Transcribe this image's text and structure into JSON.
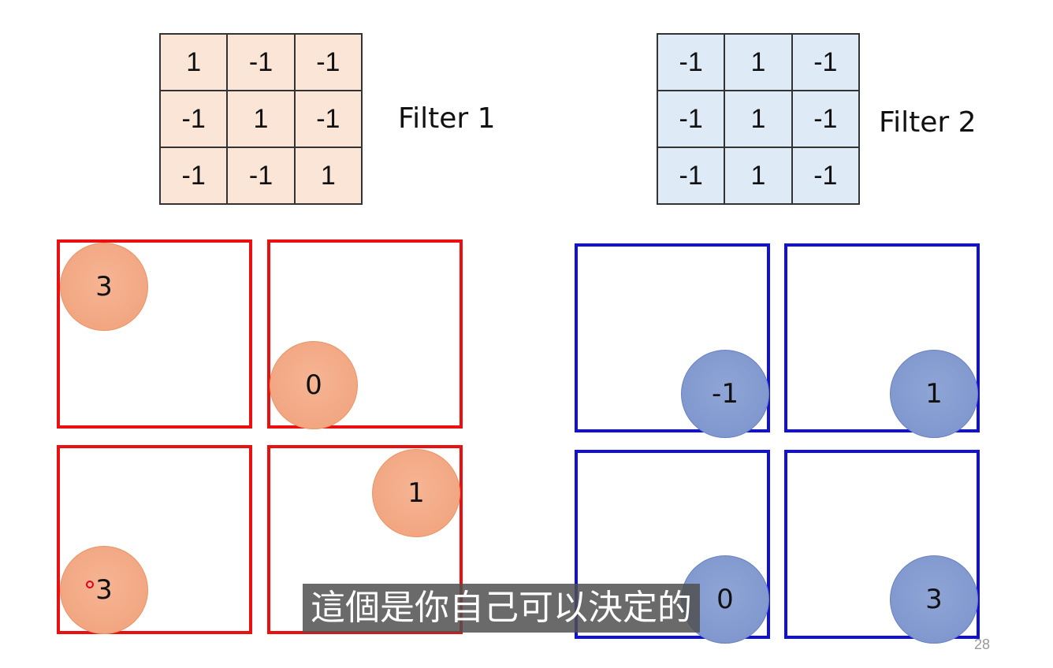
{
  "filter1": {
    "label": "Filter 1",
    "cells": [
      "1",
      "-1",
      "-1",
      "-1",
      "1",
      "-1",
      "-1",
      "-1",
      "1"
    ]
  },
  "filter2": {
    "label": "Filter 2",
    "cells": [
      "-1",
      "1",
      "-1",
      "-1",
      "1",
      "-1",
      "-1",
      "1",
      "-1"
    ]
  },
  "red_grid": [
    "3",
    "0",
    "3",
    "1"
  ],
  "blue_grid": [
    "-1",
    "1",
    "0",
    "3"
  ],
  "subtitle": "這個是你自己可以決定的",
  "page_number": "28",
  "colors": {
    "filter1_bg": "#fbe5d6",
    "filter2_bg": "#deebf7",
    "red_border": "#e81010",
    "blue_border": "#1010d8",
    "orange_circle": "#f4b08c",
    "blue_circle": "#8fa5d6"
  }
}
